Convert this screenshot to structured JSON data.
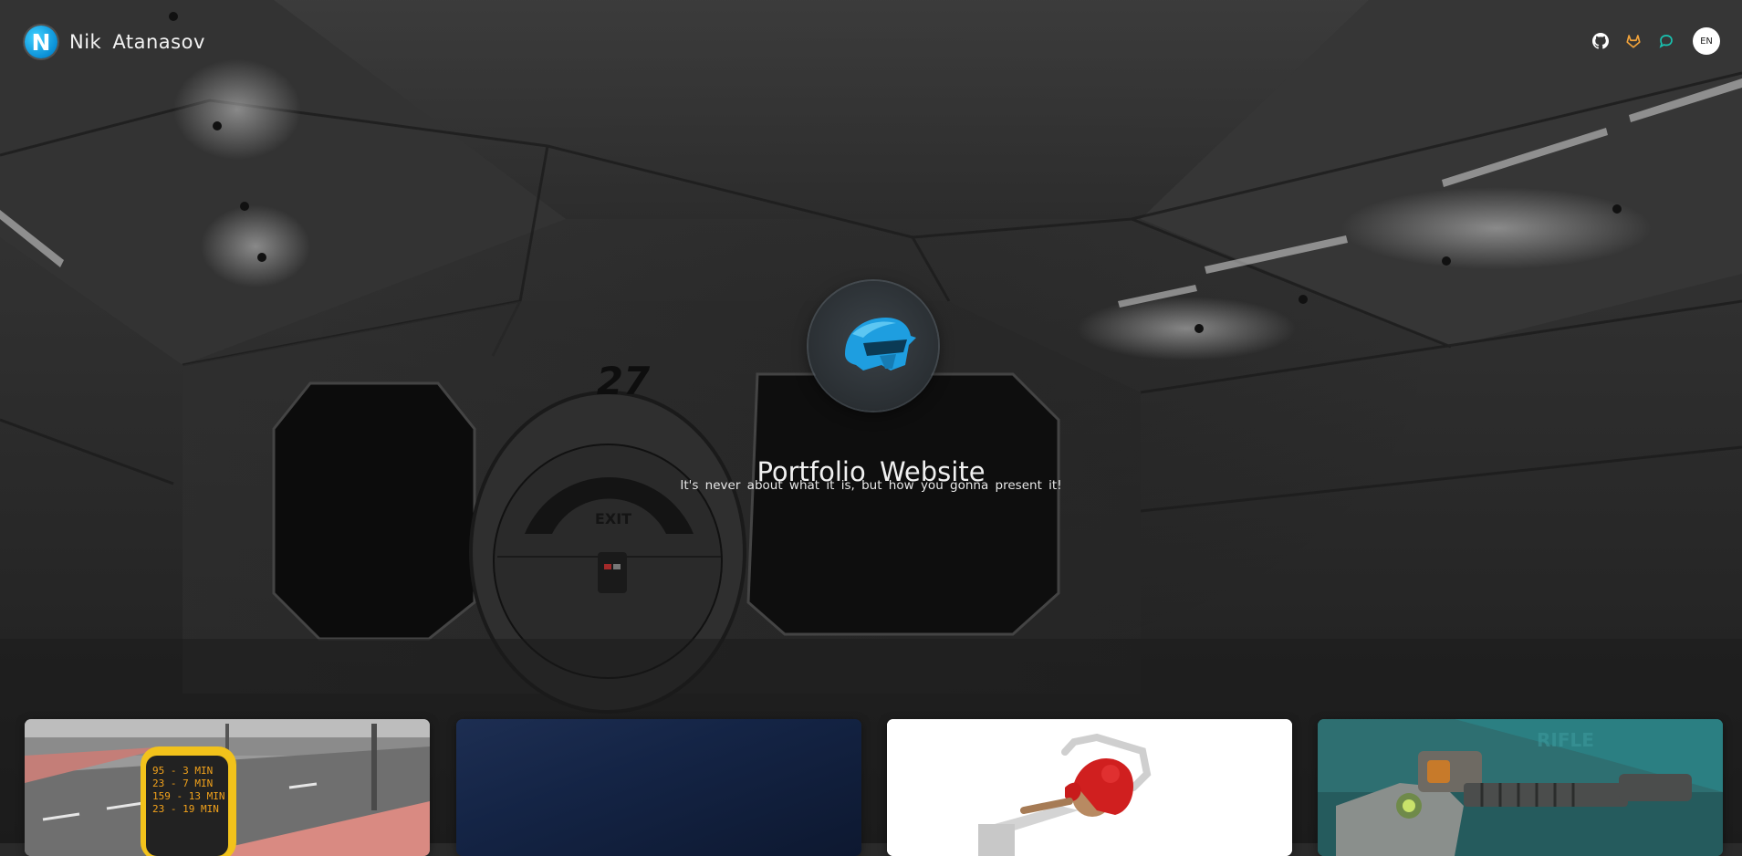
{
  "brand": {
    "logo_letter": "N",
    "name": "Nik Atanasov"
  },
  "nav": {
    "icons": [
      "github-icon",
      "gitlab-icon",
      "chat-icon"
    ],
    "language": "EN"
  },
  "hero": {
    "title": "Portfolio Website",
    "subtitle": "It's never about what it is, but how you gonna present it!",
    "avatar": "helmet-icon"
  },
  "projects": [
    {
      "image": "bus-stop-departure-display",
      "display_lines": [
        "95 - 3 MIN",
        "23 - 7 MIN",
        "159 - 13 MIN",
        "23 - 19 MIN"
      ]
    },
    {
      "image": "dark-blue-gradient"
    },
    {
      "image": "red-character-chair-render"
    },
    {
      "image": "sci-fi-gun-render"
    }
  ],
  "colors": {
    "brand_accent": "#1aa7e8",
    "github_icon": "#ffffff",
    "gitlab_icon": "#f2a33a",
    "chat_icon": "#19c2b0",
    "helmet": "#1e9ee0"
  }
}
